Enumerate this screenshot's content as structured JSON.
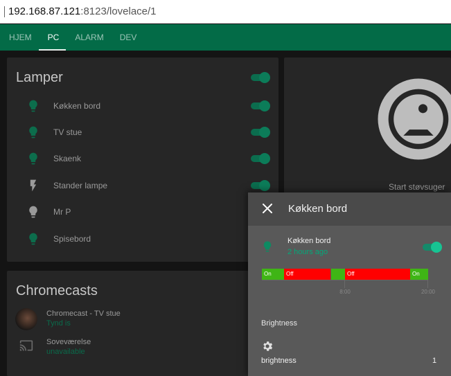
{
  "browser": {
    "url_host": "192.168.87.121",
    "url_rest": ":8123/lovelace/1"
  },
  "tabs": [
    {
      "label": "HJEM"
    },
    {
      "label": "PC"
    },
    {
      "label": "ALARM"
    },
    {
      "label": "DEV"
    }
  ],
  "lamper": {
    "title": "Lamper",
    "items": [
      {
        "label": "Køkken bord",
        "icon": "bulb-icon"
      },
      {
        "label": "TV stue",
        "icon": "bulb-icon"
      },
      {
        "label": "Skaenk",
        "icon": "bulb-icon"
      },
      {
        "label": "Stander lampe",
        "icon": "flash-icon"
      },
      {
        "label": "Mr P",
        "icon": "bulb-icon"
      },
      {
        "label": "Spisebord",
        "icon": "bulb-icon"
      }
    ]
  },
  "chromecasts": {
    "title": "Chromecasts",
    "items": [
      {
        "name": "Chromecast - TV stue",
        "status": "Tynd is"
      },
      {
        "name": "Soveværelse",
        "status": "unavailable"
      }
    ]
  },
  "vacuum": {
    "label": "Start støvsuger"
  },
  "dialog": {
    "title": "Køkken bord",
    "entity_name": "Køkken bord",
    "entity_time": "2 hours ago",
    "timeline": [
      {
        "label": "On",
        "start": 0.0,
        "end": 0.135,
        "color": "#3fb515"
      },
      {
        "label": "Off",
        "start": 0.135,
        "end": 0.415,
        "color": "#ff0000"
      },
      {
        "label": "",
        "start": 0.415,
        "end": 0.5,
        "color": "#3fb515"
      },
      {
        "label": "Off",
        "start": 0.5,
        "end": 0.89,
        "color": "#ff0000"
      },
      {
        "label": "On",
        "start": 0.89,
        "end": 1.0,
        "color": "#3fb515"
      }
    ],
    "ticks": [
      {
        "label": "8:00",
        "pos": 0.5
      },
      {
        "label": "20:00",
        "pos": 1.0
      }
    ],
    "brightness_heading": "Brightness",
    "brightness_label": "brightness",
    "brightness_value": "1"
  },
  "colors": {
    "header": "#036b47",
    "accent": "#03a97a",
    "on": "#3fb515",
    "off": "#ff0000"
  }
}
